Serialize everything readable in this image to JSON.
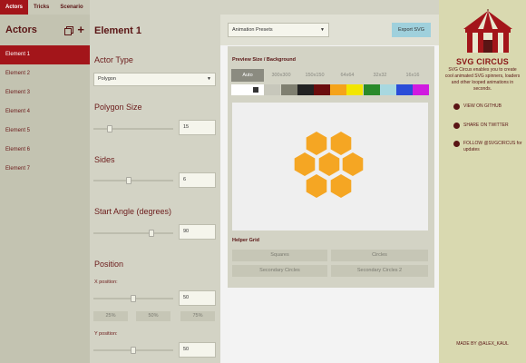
{
  "tabs": [
    {
      "label": "Actors"
    },
    {
      "label": "Tricks"
    },
    {
      "label": "Scenario"
    }
  ],
  "sidebar": {
    "title": "Actors",
    "elements": [
      {
        "label": "Element 1"
      },
      {
        "label": "Element 2"
      },
      {
        "label": "Element 3"
      },
      {
        "label": "Element 4"
      },
      {
        "label": "Element 5"
      },
      {
        "label": "Element 6"
      },
      {
        "label": "Element 7"
      }
    ]
  },
  "props": {
    "title": "Element 1",
    "actor_type_label": "Actor Type",
    "actor_type_value": "Polygon",
    "polygon_size_label": "Polygon Size",
    "polygon_size_value": "15",
    "polygon_size_slider": 0.18,
    "sides_label": "Sides",
    "sides_value": "6",
    "sides_slider": 0.44,
    "start_angle_label": "Start Angle (degrees)",
    "start_angle_value": "90",
    "start_angle_slider": 0.74,
    "position_label": "Position",
    "x_label": "X position:",
    "x_value": "50",
    "x_slider": 0.5,
    "y_label": "Y position:",
    "y_value": "50",
    "y_slider": 0.5,
    "presets": [
      "25%",
      "50%",
      "75%"
    ]
  },
  "toolbar": {
    "animation_presets": "Animation Presets",
    "export_label": "Export SVG"
  },
  "preview": {
    "size_bg_label": "Preview Size / Background",
    "sizes": [
      "Auto",
      "300x300",
      "150x150",
      "64x64",
      "32x32",
      "16x16"
    ],
    "active_size": "Auto",
    "swatches": [
      "#ffffff",
      "#333333",
      "#c7c7bb",
      "#7f7f70",
      "#222222",
      "#6b0d0d",
      "#f5a31a",
      "#f2e600",
      "#2a8a2a",
      "#a8d8e0",
      "#2a4cd8",
      "#d01ae0"
    ],
    "hex_color": "#f5a623",
    "helper_grid_label": "Helper Grid",
    "helper_buttons": [
      "Squares",
      "Circles",
      "Secondary Circles",
      "Secondary Circles 2"
    ]
  },
  "right": {
    "brand": "SVG CIRCUS",
    "description": "SVG Circus enables you to create cool animated SVG spinners, loaders and other looped animations in seconds.",
    "links": [
      {
        "icon": "github-icon",
        "label": "VIEW ON GITHUB"
      },
      {
        "icon": "twitter-icon",
        "label": "SHARE ON TWITTER"
      },
      {
        "icon": "twitter-icon",
        "label": "FOLLOW @SVGCIRCUS for updates"
      }
    ],
    "made_by": "MADE BY @ALEX_KAUL"
  },
  "colors": {
    "accent": "#a3151a",
    "panel": "#d3d3c5",
    "export": "#9fd0dc"
  }
}
